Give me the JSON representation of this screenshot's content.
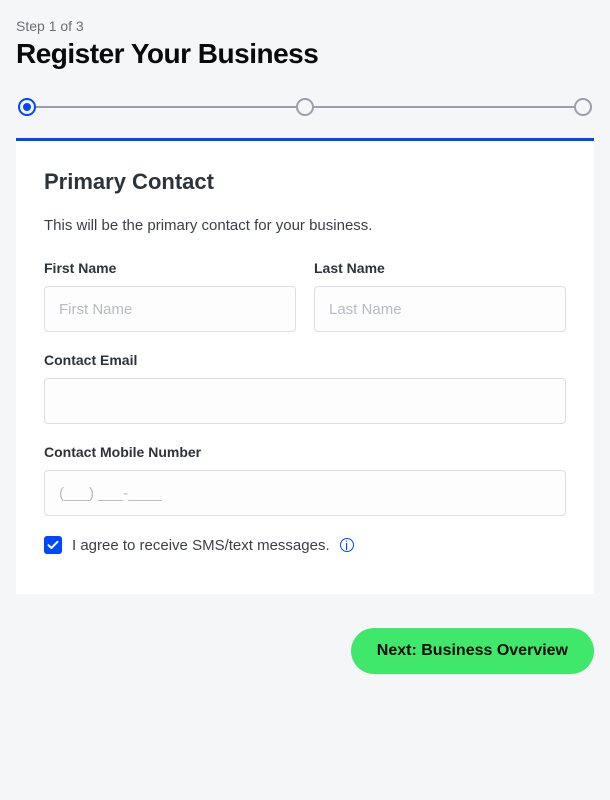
{
  "header": {
    "step_label": "Step 1 of 3",
    "title": "Register Your Business"
  },
  "progress": {
    "current_step": 1,
    "total_steps": 3
  },
  "card": {
    "title": "Primary Contact",
    "description": "This will be the primary contact for your business.",
    "fields": {
      "first_name": {
        "label": "First Name",
        "placeholder": "First Name",
        "value": ""
      },
      "last_name": {
        "label": "Last Name",
        "placeholder": "Last Name",
        "value": ""
      },
      "email": {
        "label": "Contact Email",
        "placeholder": "",
        "value": ""
      },
      "mobile": {
        "label": "Contact Mobile Number",
        "placeholder": "(___) ___-____",
        "value": ""
      }
    },
    "consent": {
      "checked": true,
      "label": "I agree to receive SMS/text messages."
    }
  },
  "footer": {
    "next_label": "Next: Business Overview"
  }
}
